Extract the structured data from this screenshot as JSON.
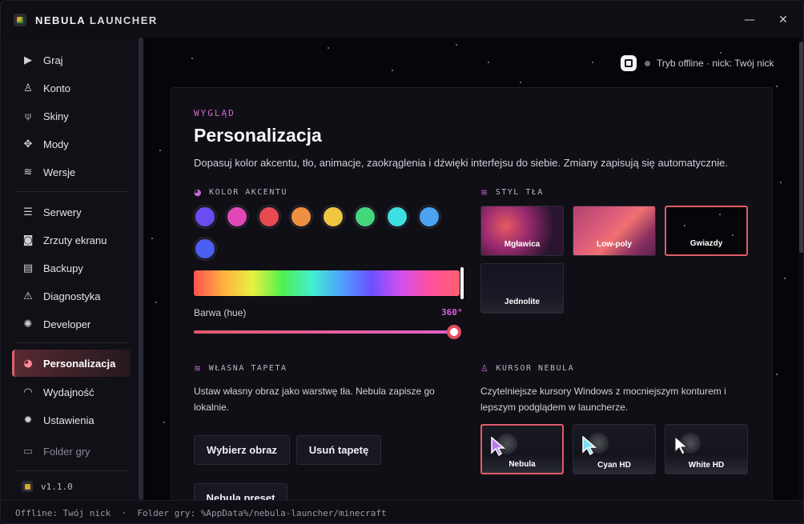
{
  "app": {
    "title_bold": "NEBULA",
    "title_rest": "LAUNCHER",
    "min_icon": "minimize-icon",
    "close_icon": "close-icon"
  },
  "sidebar": {
    "items": [
      {
        "label": "Graj",
        "icon": "play-icon",
        "glyph": "▶"
      },
      {
        "label": "Konto",
        "icon": "user-icon",
        "glyph": "♙"
      },
      {
        "label": "Skiny",
        "icon": "shirt-icon",
        "glyph": "⍦"
      },
      {
        "label": "Mody",
        "icon": "puzzle-icon",
        "glyph": "✥"
      },
      {
        "label": "Wersje",
        "icon": "layers-icon",
        "glyph": "≋"
      },
      {
        "label": "Serwery",
        "icon": "server-icon",
        "glyph": "☰"
      },
      {
        "label": "Zrzuty ekranu",
        "icon": "camera-icon",
        "glyph": "◙"
      },
      {
        "label": "Backupy",
        "icon": "archive-icon",
        "glyph": "▤"
      },
      {
        "label": "Diagnostyka",
        "icon": "warning-icon",
        "glyph": "⚠"
      },
      {
        "label": "Developer",
        "icon": "gear-icon",
        "glyph": "✺"
      },
      {
        "label": "Personalizacja",
        "icon": "palette-icon",
        "glyph": "◕"
      },
      {
        "label": "Wydajność",
        "icon": "gauge-icon",
        "glyph": "◠"
      },
      {
        "label": "Ustawienia",
        "icon": "settings-icon",
        "glyph": "✹"
      },
      {
        "label": "Folder gry",
        "icon": "folder-icon",
        "glyph": "▭"
      }
    ],
    "version": "v1.1.0"
  },
  "status": {
    "text": "Tryb offline · nick: Twój nick"
  },
  "page": {
    "eyebrow": "WYGLĄD",
    "title": "Personalizacja",
    "description": "Dopasuj kolor akcentu, tło, animacje, zaokrąglenia i dźwięki interfejsu do siebie. Zmiany zapisują się automatycznie."
  },
  "accent": {
    "section_title": "KOLOR AKCENTU",
    "swatches": [
      "#6a4cf0",
      "#e048b8",
      "#e84a52",
      "#ee9040",
      "#eec640",
      "#44d67c",
      "#3ce0e0",
      "#4aa2f0",
      "#4a5ef0"
    ],
    "hue_label": "Barwa (hue)",
    "hue_value": "360°",
    "hue_level": 1.0
  },
  "background": {
    "section_title": "STYL TŁA",
    "options": [
      {
        "label": "Mgławica",
        "selected": false
      },
      {
        "label": "Low-poly",
        "selected": false
      },
      {
        "label": "Gwiazdy",
        "selected": true
      },
      {
        "label": "Jednolite",
        "selected": false
      }
    ]
  },
  "wallpaper": {
    "section_title": "WŁASNA TAPETA",
    "description": "Ustaw własny obraz jako warstwę tła. Nebula zapisze go lokalnie.",
    "choose_label": "Wybierz obraz",
    "remove_label": "Usuń tapetę",
    "preset_label": "Nebula preset"
  },
  "cursor": {
    "section_title": "KURSOR NEBULA",
    "description": "Czytelniejsze kursory Windows z mocniejszym konturem i lepszym podglądem w launcherze.",
    "options": [
      {
        "label": "Nebula",
        "selected": true,
        "color": "#b87af0"
      },
      {
        "label": "Cyan HD",
        "selected": false,
        "color": "#7adcf0"
      },
      {
        "label": "White HD",
        "selected": false,
        "color": "#ffffff"
      }
    ]
  },
  "footer": {
    "text": "Offline: Twój nick  ·  Folder gry: %AppData%/nebula-launcher/minecraft"
  }
}
